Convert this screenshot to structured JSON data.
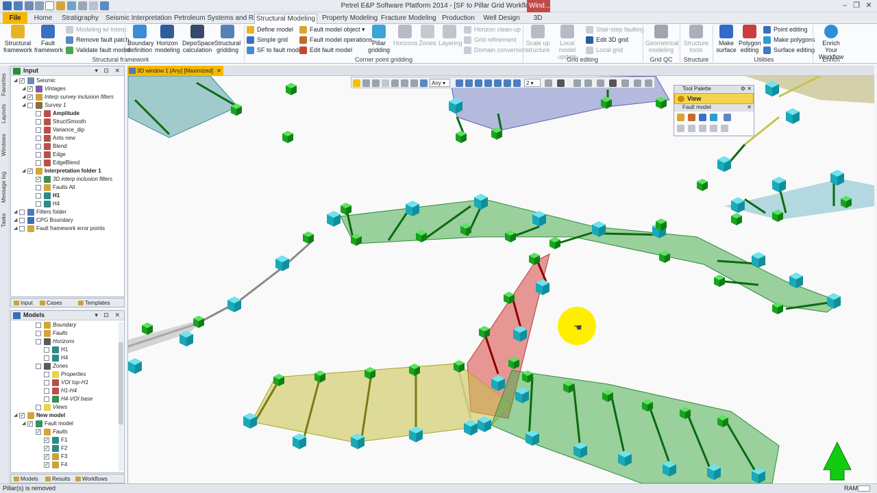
{
  "window": {
    "title": "Petrel E&P Software Platform 2014 - [SF to Pillar Grid Workflow]",
    "badge": "Wind..."
  },
  "menu_tabs": [
    "File",
    "Home",
    "Stratigraphy",
    "Seismic Interpretation",
    "Petroleum Systems and Risk",
    "Structural Modeling",
    "Property Modeling",
    "Fracture Modeling",
    "Production",
    "Well Design",
    "3D"
  ],
  "active_tab": "Structural Modeling",
  "ribbon": {
    "structural_framework": {
      "b1": "Structural\nframework",
      "b2": "Fault\nframework",
      "s1": "Modeling w/ interp.",
      "s2": "Remove fault patch",
      "s3": "Validate fault model",
      "label": "Structural framework"
    },
    "corner_point": {
      "b1": "Boundary\ndefinition",
      "b2": "Horizon\nmodeling",
      "b3": "DepoSpace\ncalculation",
      "b4": "Structural\ngridding",
      "c1": "Define model",
      "c2": "Simple grid",
      "c3": "SF to fault model",
      "d1": "Fault model object",
      "d2": "Fault model operations",
      "d3": "Edit fault model",
      "b5": "Pillar\ngridding",
      "b6": "Horizons",
      "b7": "Zones",
      "b8": "Layering",
      "e1": "Horizon clean-up",
      "e2": "Grid refinement",
      "e3": "Domain conversion",
      "label": "Corner point gridding"
    },
    "grid_editing": {
      "b1": "Scale up\nstructure",
      "b2": "Local model\nupdate",
      "s1": "Stair-step faulting",
      "s2": "Edit 3D grid",
      "s3": "Local grid",
      "label": "Grid editing"
    },
    "grid_qc": {
      "b1": "Geometrical\nmodeling",
      "label": "Grid QC"
    },
    "structure": {
      "b1": "Structure\ntools",
      "label": "Structure"
    },
    "utilities": {
      "b1": "Make\nsurface",
      "b2": "Polygon\nediting",
      "s1": "Point editing",
      "s2": "Make polygons",
      "s3": "Surface editing",
      "label": "Utilities"
    },
    "enrich": {
      "b1": "Enrich Your\nWorkflow",
      "label": "Enrich"
    }
  },
  "side_tabs": [
    "Favorites",
    "Layouts",
    "Windows",
    "Message log",
    "Tasks"
  ],
  "input_panel": {
    "title": "Input",
    "items": [
      {
        "label": "Seismic",
        "indent": 0,
        "italic": false,
        "bold": false
      },
      {
        "label": "Vintages",
        "indent": 1,
        "italic": true,
        "bold": false
      },
      {
        "label": "Interp survey inclusion filters",
        "indent": 1,
        "italic": true,
        "bold": false
      },
      {
        "label": "Survey 1",
        "indent": 1,
        "italic": true,
        "bold": false
      },
      {
        "label": "Amplitude",
        "indent": 2,
        "italic": false,
        "bold": true
      },
      {
        "label": "StructSmooth",
        "indent": 2,
        "italic": false,
        "bold": false
      },
      {
        "label": "Variance_dip",
        "indent": 2,
        "italic": false,
        "bold": false
      },
      {
        "label": "Ants new",
        "indent": 2,
        "italic": false,
        "bold": false
      },
      {
        "label": "Blend",
        "indent": 2,
        "italic": false,
        "bold": false
      },
      {
        "label": "Edge",
        "indent": 2,
        "italic": false,
        "bold": false
      },
      {
        "label": "EdgeBlend",
        "indent": 2,
        "italic": false,
        "bold": false
      },
      {
        "label": "Interpretation folder 1",
        "indent": 1,
        "italic": false,
        "bold": true
      },
      {
        "label": "3D interp inclusion filters",
        "indent": 2,
        "italic": true,
        "bold": false
      },
      {
        "label": "Faults All",
        "indent": 2,
        "italic": false,
        "bold": false
      },
      {
        "label": "H1",
        "indent": 2,
        "italic": false,
        "bold": true
      },
      {
        "label": "H4",
        "indent": 2,
        "italic": false,
        "bold": false
      },
      {
        "label": "Filters folder",
        "indent": 0,
        "italic": false,
        "bold": false
      },
      {
        "label": "CPG Boundary",
        "indent": 0,
        "italic": false,
        "bold": false
      },
      {
        "label": "Fault framework error points",
        "indent": 0,
        "italic": false,
        "bold": false
      }
    ],
    "tabs": [
      "Input",
      "Cases",
      "Templates"
    ]
  },
  "models_panel": {
    "title": "Models",
    "items": [
      {
        "label": "Boundary",
        "indent": 2,
        "italic": true,
        "bold": false
      },
      {
        "label": "Faults",
        "indent": 2,
        "italic": true,
        "bold": false
      },
      {
        "label": "Horizons",
        "indent": 2,
        "italic": true,
        "bold": false
      },
      {
        "label": "H1",
        "indent": 3,
        "italic": false,
        "bold": false
      },
      {
        "label": "H4",
        "indent": 3,
        "italic": false,
        "bold": false
      },
      {
        "label": "Zones",
        "indent": 2,
        "italic": true,
        "bold": false
      },
      {
        "label": "Properties",
        "indent": 3,
        "italic": true,
        "bold": false
      },
      {
        "label": "VOI top-H1",
        "indent": 3,
        "italic": true,
        "bold": false
      },
      {
        "label": "H1-H4",
        "indent": 3,
        "italic": true,
        "bold": false
      },
      {
        "label": "H4-VOI base",
        "indent": 3,
        "italic": true,
        "bold": false
      },
      {
        "label": "Views",
        "indent": 2,
        "italic": true,
        "bold": false
      },
      {
        "label": "New model",
        "indent": 0,
        "italic": false,
        "bold": true
      },
      {
        "label": "Fault model",
        "indent": 1,
        "italic": false,
        "bold": false
      },
      {
        "label": "Faults",
        "indent": 2,
        "italic": true,
        "bold": false
      },
      {
        "label": "F1",
        "indent": 3,
        "italic": false,
        "bold": false
      },
      {
        "label": "F2",
        "indent": 3,
        "italic": false,
        "bold": false
      },
      {
        "label": "F3",
        "indent": 3,
        "italic": false,
        "bold": false
      },
      {
        "label": "F4",
        "indent": 3,
        "italic": false,
        "bold": false
      }
    ],
    "tabs": [
      "Models",
      "Results",
      "Workflows"
    ]
  },
  "viewport": {
    "tab_label": "3D window 1 [Any] [Maximized]",
    "toolbar": {
      "domain": "Any",
      "value": "2"
    }
  },
  "tool_palette": {
    "title": "Tool Palette",
    "view": "View",
    "section": "Fault model"
  },
  "status": {
    "message": "Pillar(s) is removed",
    "ram": "RAM"
  },
  "colors": {
    "accent": "#f5b800",
    "pillar_cube_cyan": "#20c7d6",
    "pillar_cube_green": "#1fbf2a",
    "fault_green": "#4caf50",
    "fault_red": "#d9534f",
    "fault_yellow": "#c8c24a",
    "fault_blue": "#7b85c9",
    "fault_teal": "#5aa4a8",
    "cursor_highlight": "#ffee00",
    "north_arrow": "#11cc11"
  }
}
